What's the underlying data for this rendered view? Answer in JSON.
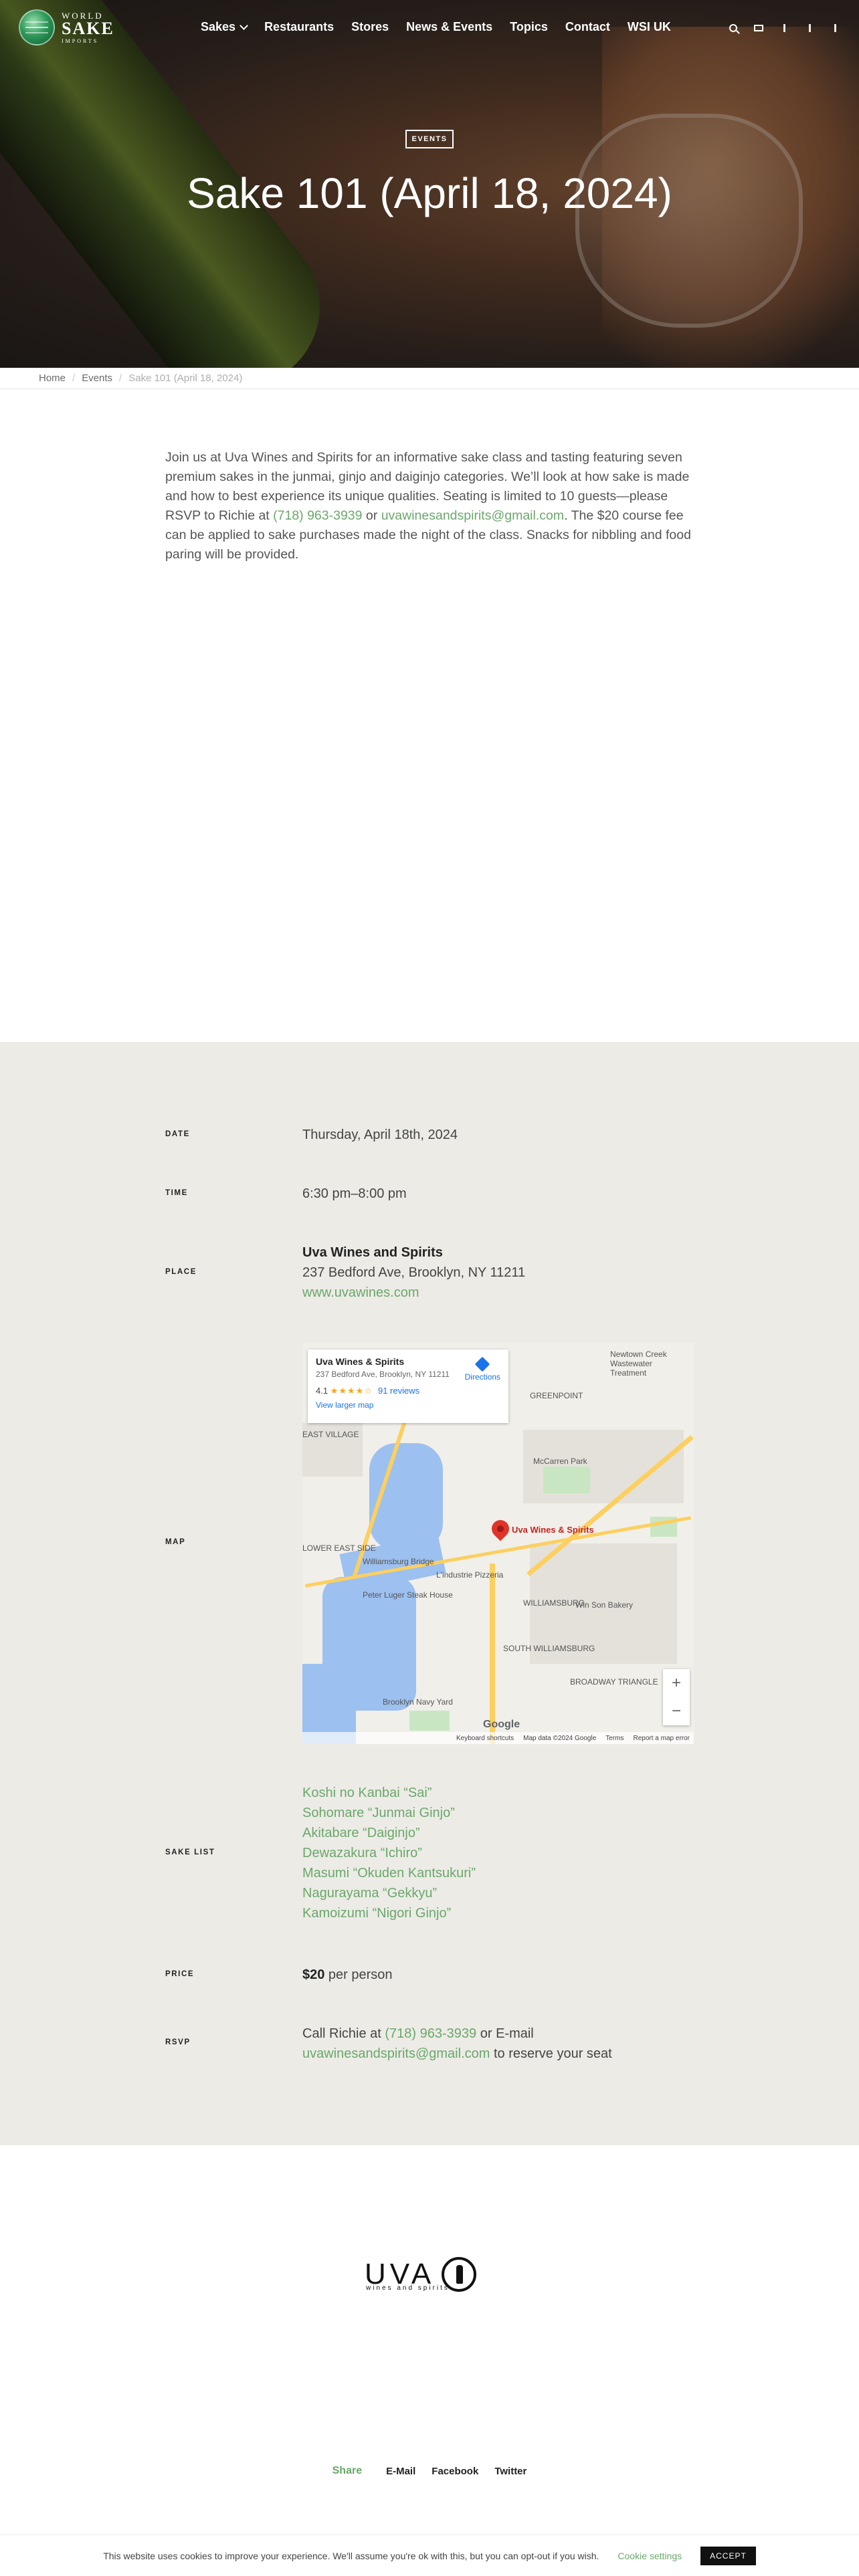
{
  "brand": {
    "line1": "WORLD",
    "line2": "SAKE",
    "line3": "IMPORTS"
  },
  "nav": {
    "items": [
      "Sakes",
      "Restaurants",
      "Stores",
      "News & Events",
      "Topics",
      "Contact",
      "WSI UK"
    ]
  },
  "header_icons": [
    "search-icon",
    "mail-icon",
    "facebook-icon",
    "twitter-icon",
    "instagram-icon"
  ],
  "hero": {
    "badge": "EVENTS",
    "title": "Sake 101 (April 18, 2024)"
  },
  "breadcrumb": {
    "home": "Home",
    "events": "Events",
    "current": "Sake 101 (April 18, 2024)"
  },
  "intro": {
    "p1": "Join us at Uva Wines and Spirits for an informative sake class and tasting featuring seven premium sakes in the junmai, ginjo and daiginjo categories. We’ll look at how sake is made and how to best experience its unique qualities. Seating is limited to 10 guests—please RSVP to Richie at ",
    "phone": "(718) 963-3939",
    "or": " or ",
    "email": "uvawinesandspirits@gmail.com",
    "p2": ". The $20 course fee can be applied to sake purchases made the night of the class. Snacks for nibbling and food paring will be provided."
  },
  "details": {
    "date_label": "DATE",
    "date": "Thursday, April 18th, 2024",
    "time_label": "TIME",
    "time": "6:30 pm–8:00 pm",
    "place_label": "PLACE",
    "place_name": "Uva Wines and Spirits",
    "place_address": "237 Bedford Ave, Brooklyn, NY 11211",
    "place_url": "www.uvawines.com",
    "map_label": "MAP",
    "sake_label": "SAKE LIST",
    "sakes": [
      "Koshi no Kanbai “Sai”",
      "Sohomare “Junmai Ginjo”",
      "Akitabare “Daiginjo”",
      "Dewazakura “Ichiro”",
      "Masumi “Okuden Kantsukuri”",
      "Nagurayama “Gekkyu”",
      "Kamoizumi “Nigori Ginjo”"
    ],
    "price_label": "PRICE",
    "price_amount": "$20",
    "price_suffix": " per person",
    "rsvp_label": "RSVP",
    "rsvp_prefix": "Call Richie at ",
    "rsvp_phone": "(718) 963-3939",
    "rsvp_mid": " or E-mail ",
    "rsvp_email": "uvawinesandspirits@gmail.com",
    "rsvp_suffix": " to reserve your seat"
  },
  "map": {
    "card_name": "Uva Wines & Spirits",
    "card_address": "237 Bedford Ave, Brooklyn, NY 11211",
    "rating": "4.1",
    "stars": "★★★★☆",
    "reviews": "91 reviews",
    "larger": "View larger map",
    "directions": "Directions",
    "pin_label": "Uva Wines & Spirits",
    "labels": [
      "GREENPOINT",
      "WILLIAMSBURG",
      "SOUTH WILLIAMSBURG",
      "BROADWAY TRIANGLE",
      "Williamsburg Bridge",
      "McCarren Park",
      "Brooklyn Navy Yard",
      "Peter Luger Steak House",
      "L'industrie Pizzeria",
      "Win Son Bakery",
      "EAST VILLAGE",
      "LOWER EAST SIDE",
      "Newtown Creek Wastewater Treatment"
    ],
    "google": "Google",
    "footer": [
      "Keyboard shortcuts",
      "Map data ©2024 Google",
      "Terms",
      "Report a map error"
    ]
  },
  "uva": {
    "word": "UVA",
    "sub": "wines and spirits"
  },
  "share": {
    "title": "Share",
    "links": [
      "E-Mail",
      "Facebook",
      "Twitter"
    ]
  },
  "cookie": {
    "text": "This website uses cookies to improve your experience. We'll assume you're ok with this, but you can opt-out if you wish.",
    "settings": "Cookie settings",
    "accept": "ACCEPT"
  }
}
